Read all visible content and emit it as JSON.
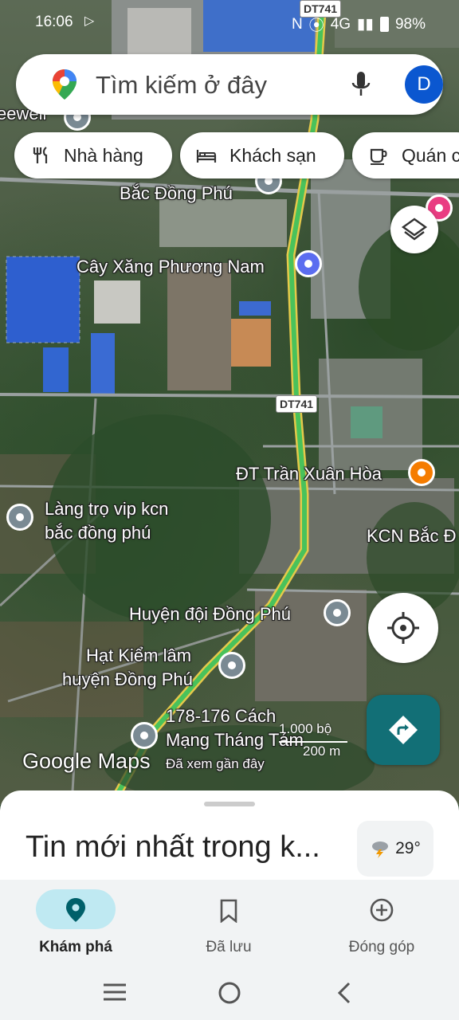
{
  "status_bar": {
    "time": "16:06",
    "network": "4G",
    "battery": "98%"
  },
  "search": {
    "placeholder": "Tìm kiếm ở đây",
    "avatar_letter": "D"
  },
  "chips": [
    {
      "label": "Nhà hàng",
      "icon": "fork-knife-icon"
    },
    {
      "label": "Khách sạn",
      "icon": "bed-icon"
    },
    {
      "label": "Quán c",
      "icon": "coffee-cup-icon"
    }
  ],
  "map": {
    "road_shields": [
      "DT741",
      "DT741"
    ],
    "labels": [
      "eewell",
      "Bắc Đồng Phú",
      "Cây Xăng Phương Nam",
      "ĐT Trần Xuân Hòa",
      "Làng trọ vip kcn",
      "bắc đồng phú",
      "KCN Bắc Đ",
      "Huyện đội Đồng Phú",
      "Hạt Kiểm lâm",
      "huyện Đồng Phú",
      "178-176 Cách",
      "Mạng Tháng Tám",
      "Đã xem gần đây"
    ],
    "logo": "Google Maps",
    "scale_top": "1.000 bộ",
    "scale_bottom": "200 m"
  },
  "sheet": {
    "news_title": "Tin mới nhất trong k...",
    "temperature": "29°"
  },
  "bottom_nav": [
    {
      "label": "Khám phá",
      "icon": "explore-pin-icon",
      "active": true
    },
    {
      "label": "Đã lưu",
      "icon": "bookmark-icon",
      "active": false
    },
    {
      "label": "Đóng góp",
      "icon": "add-circle-icon",
      "active": false
    }
  ],
  "colors": {
    "accent": "#0b57d0",
    "directions": "#126f76",
    "active_pill": "#bfe9f2"
  }
}
